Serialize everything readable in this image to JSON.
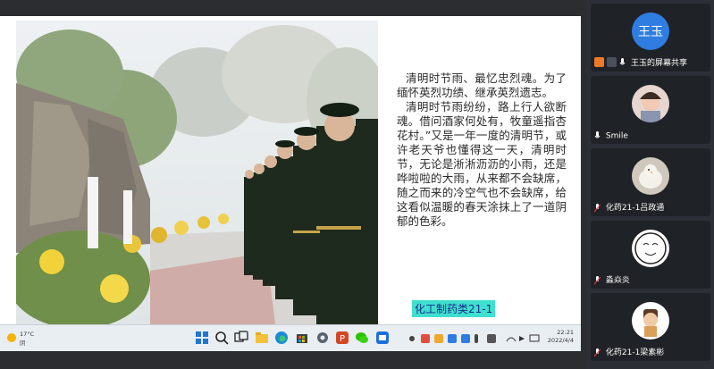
{
  "slide": {
    "paragraph1": "清明时节雨、最忆忠烈魂。为了缅怀英烈功绩、继承英烈遗志。",
    "paragraph2": "清明时节雨纷纷，路上行人欲断魂。借问酒家何处有，牧童遥指杏花村。”又是一年一度的清明节，或许老天爷也懂得这一天，清明时节，无论是淅淅沥沥的小雨，还是哗啦啦的大雨，从来都不会缺席，随之而来的冷空气也不会缺席，给这看似温暖的春天涂抹上了一道阴郁的色彩。",
    "caption": "化工制药类21-1"
  },
  "taskbar": {
    "temperature": "17°C",
    "condition": "阴",
    "time": "22:21",
    "date": "2022/4/4"
  },
  "participants": [
    {
      "name": "王玉",
      "avatar_text": "王玉",
      "status": "王玉的屏幕共享",
      "sharing": true
    },
    {
      "name": "Smile",
      "sharing": false
    },
    {
      "name": "化药21-1吕政通",
      "sharing": false
    },
    {
      "name": "淼焱炎",
      "sharing": false
    },
    {
      "name": "化药21-1梁素彬",
      "sharing": false
    }
  ],
  "colors": {
    "caption_bg": "#3fe0cf",
    "avatar_blue": "#2f7de1",
    "panel_bg": "#2c2f35"
  },
  "icons": [
    "start-icon",
    "search-icon",
    "taskview-icon",
    "file-explorer-icon",
    "edge-icon",
    "store-icon",
    "settings-icon",
    "powerpoint-icon",
    "wechat-icon",
    "meeting-icon",
    "mic-icon",
    "screen-share-icon"
  ]
}
